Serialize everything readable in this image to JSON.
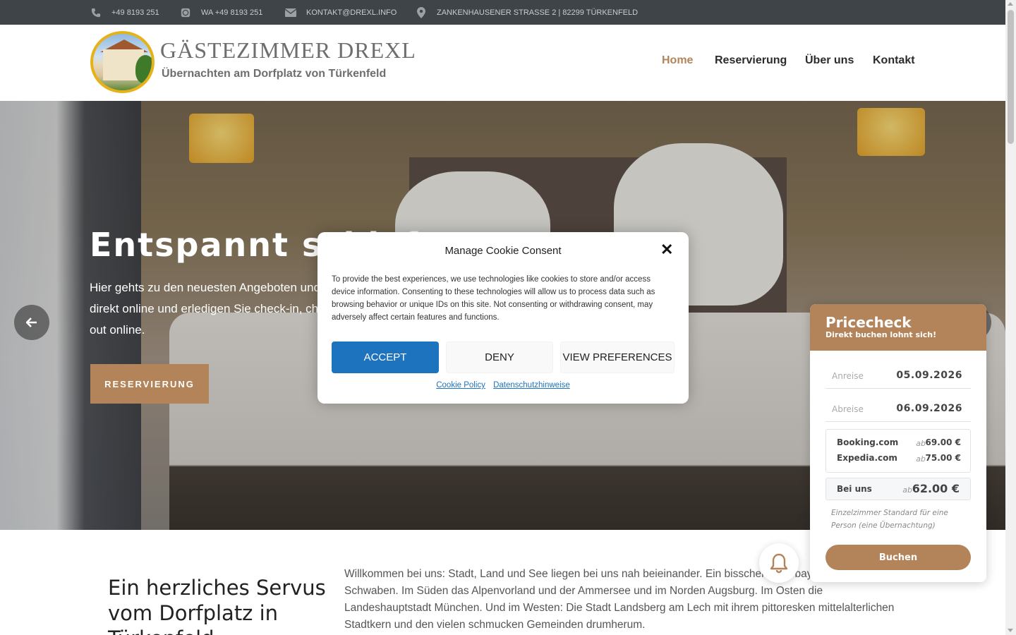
{
  "topbar": {
    "phone": "+49 8193 251",
    "whatsapp": "WA +49 8193 251",
    "email": "KONTAKT@DREXL.INFO",
    "address": "ZANKENHAUSENER STRASSE 2 | 82299 TÜRKENFELD"
  },
  "header": {
    "logo_title": "GÄSTEZIMMER DREXL",
    "logo_subtitle": "Übernachten am Dorfplatz von Türkenfeld",
    "nav": {
      "home": "Home",
      "reservierung": "Reservierung",
      "ueber_uns": "Über uns",
      "kontakt": "Kontakt"
    }
  },
  "hero": {
    "title": "Entspannt schlafen",
    "text": "Hier gehts zu den neuesten Angeboten und direkt online und erledigen Sie check-in, check-out online.",
    "button": "RESERVIERUNG"
  },
  "content": {
    "title": "Ein herzliches Servus vom Dorfplatz in Türkenfeld",
    "text": "Willkommen bei uns: Stadt, Land und See liegen bei uns nah beieinander. Ein bisschen Oberbayern, ein bisschen Schwaben. Im Süden das Alpenvorland und der Ammersee und im Norden Augsburg. Im Osten die Landeshauptstadt München. Und im Westen: Die Stadt Landsberg am Lech mit ihrem pittoresken mittelalterlichen Stadtkern und den vielen schmucken Gemeinden drumherum."
  },
  "cookie": {
    "title": "Manage Cookie Consent",
    "body": "To provide the best experiences, we use technologies like cookies to store and/or access device information. Consenting to these technologies will allow us to process data such as browsing behavior or unique IDs on this site. Not consenting or withdrawing consent, may adversely affect certain features and functions.",
    "accept": "ACCEPT",
    "deny": "DENY",
    "preferences": "VIEW PREFERENCES",
    "link_cookie_policy": "Cookie Policy",
    "link_privacy": "Datenschutzhinweise",
    "close_symbol": "✕"
  },
  "pricecheck": {
    "title": "Pricecheck",
    "subtitle": "Direkt buchen lohnt sich!",
    "arrival_label": "Anreise",
    "arrival_value": "05.09.2026",
    "departure_label": "Abreise",
    "departure_value": "06.09.2026",
    "ota": [
      {
        "name": "Booking.com",
        "prefix": "ab",
        "price": "69.00 €"
      },
      {
        "name": "Expedia.com",
        "prefix": "ab",
        "price": "75.00 €"
      }
    ],
    "direct": {
      "name": "Bei uns",
      "prefix": "ab",
      "price": "62.00 €"
    },
    "note": "Einzelzimmer Standard für eine Person (eine Übernachtung)",
    "button": "Buchen"
  },
  "colors": {
    "accent": "#b3845a",
    "topbar": "#3f4449",
    "accept_button": "#1e73be"
  },
  "icons": {
    "phone": "phone-icon",
    "whatsapp": "whatsapp-icon",
    "email": "envelope-icon",
    "address": "map-marker-icon",
    "prev": "arrow-left-icon",
    "next": "arrow-right-icon",
    "close": "close-icon",
    "bell": "bell-icon"
  }
}
